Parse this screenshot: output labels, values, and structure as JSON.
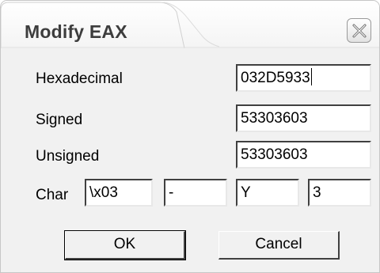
{
  "dialog": {
    "title": "Modify EAX",
    "close_icon": "close-x-icon"
  },
  "fields": {
    "hexadecimal": {
      "label": "Hexadecimal",
      "value": "032D5933"
    },
    "signed": {
      "label": "Signed",
      "value": "53303603"
    },
    "unsigned": {
      "label": "Unsigned",
      "value": "53303603"
    },
    "char": {
      "label": "Char",
      "values": [
        "\\x03",
        "-",
        "Y",
        "3"
      ]
    }
  },
  "buttons": {
    "ok": "OK",
    "cancel": "Cancel"
  }
}
